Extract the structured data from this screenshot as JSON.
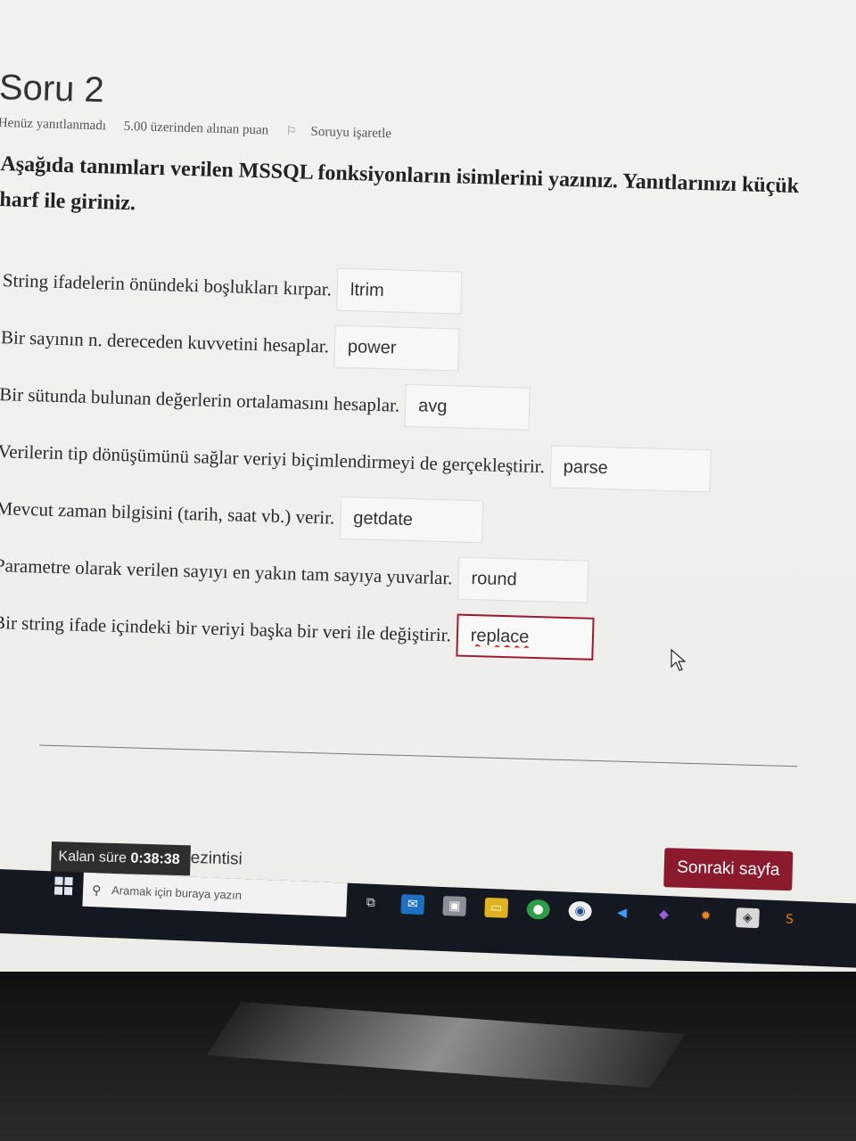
{
  "question": {
    "title": "Soru 2",
    "status": "Henüz yanıtlanmadı",
    "points": "5.00 üzerinden alınan puan",
    "flag_label": "Soruyu işaretle",
    "instructions": "Aşağıda tanımları verilen MSSQL fonksiyonların isimlerini yazınız. Yanıtlarınızı küçük harf ile giriniz."
  },
  "answers": [
    {
      "label": "String ifadelerin önündeki boşlukları kırpar.",
      "value": "ltrim"
    },
    {
      "label": "Bir sayının n. dereceden kuvvetini hesaplar.",
      "value": "power"
    },
    {
      "label": "Bir sütunda bulunan değerlerin ortalamasını hesaplar.",
      "value": "avg"
    },
    {
      "label": "Verilerin tip dönüşümünü sağlar veriyi biçimlendirmeyi de gerçekleştirir.",
      "value": "parse"
    },
    {
      "label": "Mevcut zaman bilgisini (tarih, saat vb.) verir.",
      "value": "getdate"
    },
    {
      "label": "Parametre olarak verilen sayıyı en yakın tam sayıya yuvarlar.",
      "value": "round"
    },
    {
      "label": "Bir string ifade içindeki bir veriyi başka bir veri ile değiştirir.",
      "value": "replace"
    }
  ],
  "navigation": {
    "next_label": "Sonraki sayfa"
  },
  "timer": {
    "label": "Kalan süre",
    "value": "0:38:38",
    "partial_text": "ezintisi"
  },
  "taskbar": {
    "search_placeholder": "Aramak için buraya yazın"
  },
  "colors": {
    "accent": "#8b1a2c",
    "active_border": "#9b1b30",
    "taskbar": "#141821"
  }
}
